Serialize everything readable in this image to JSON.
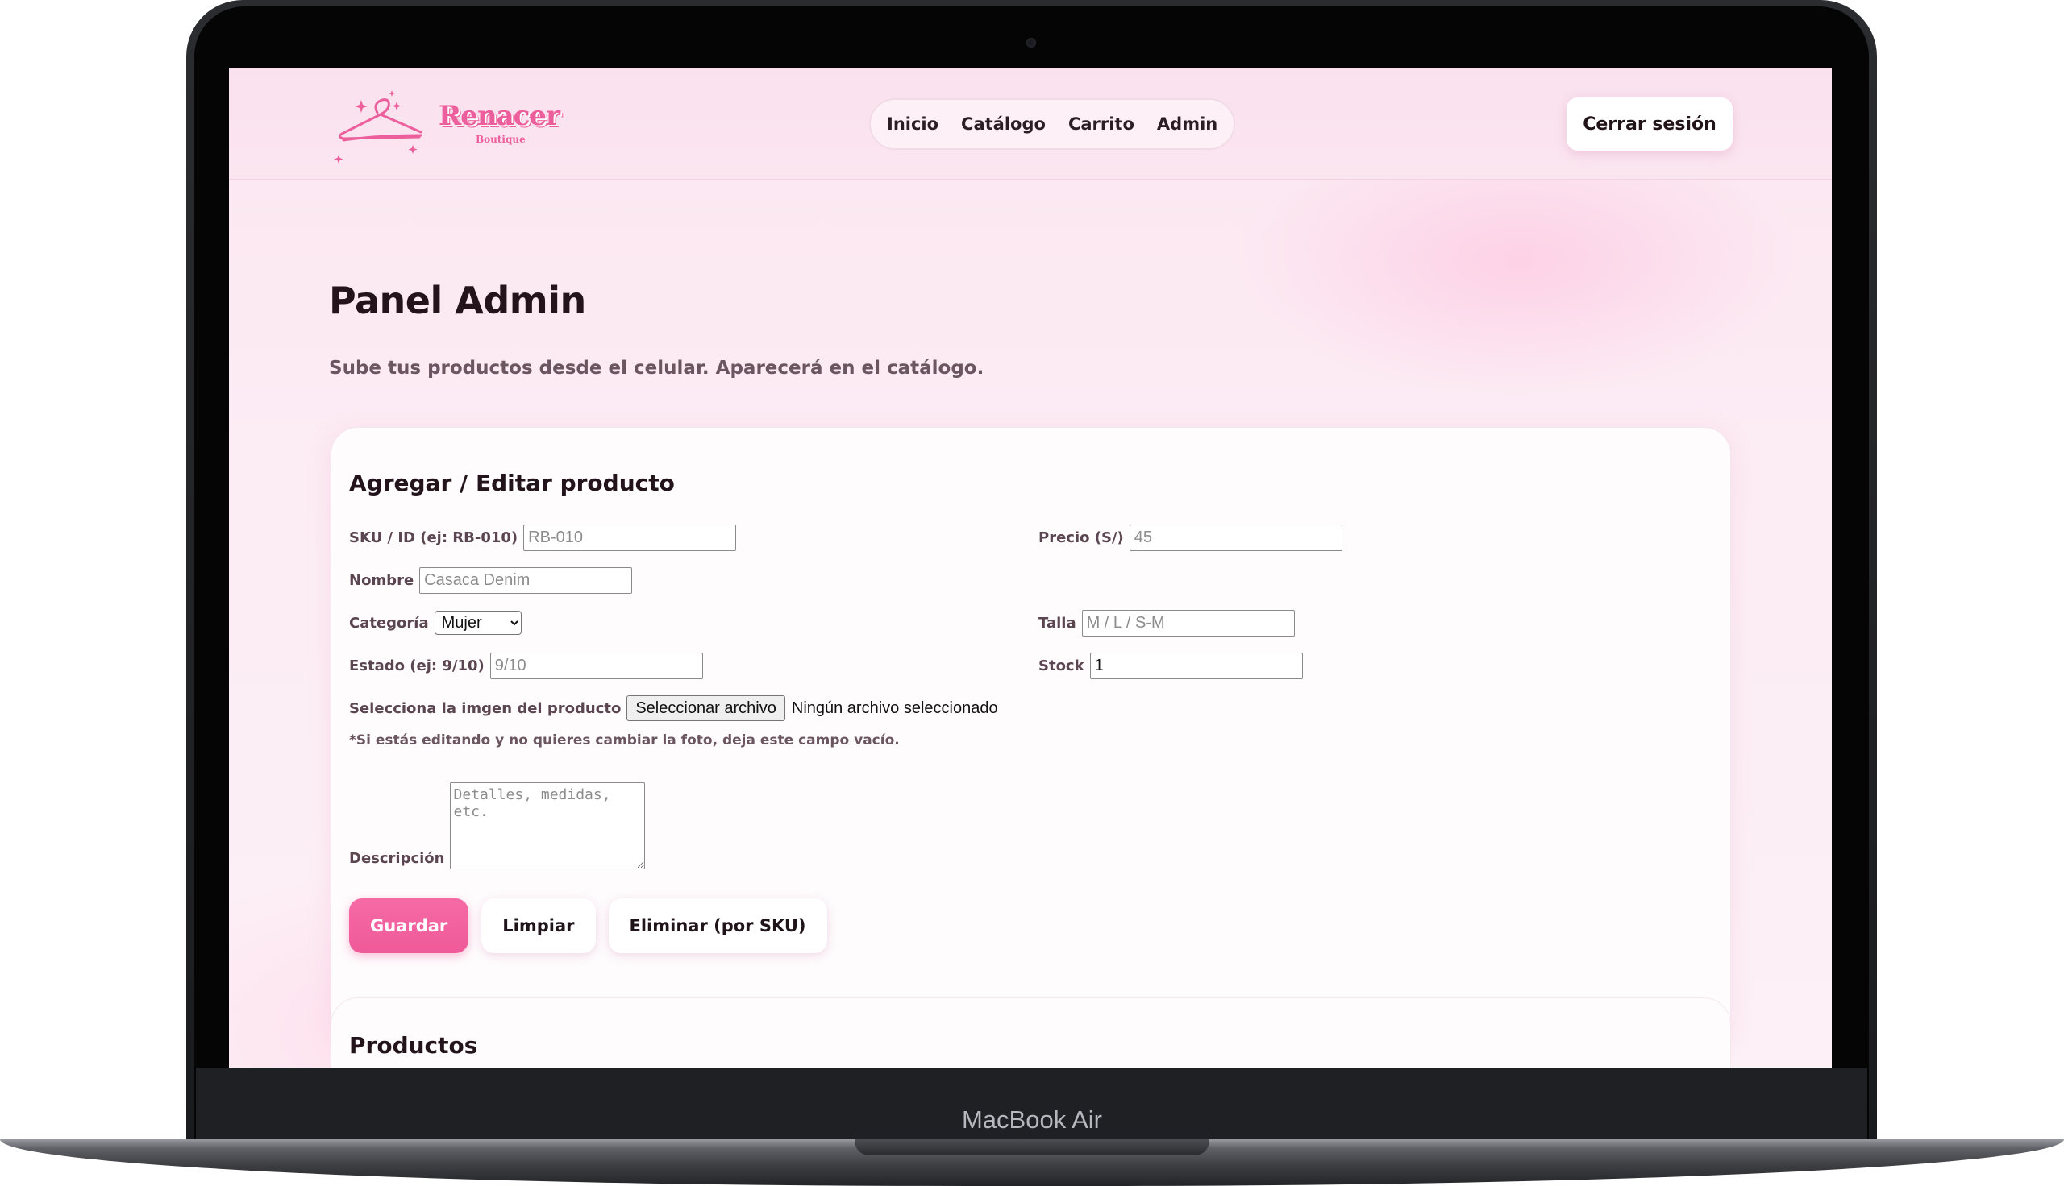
{
  "device": {
    "model_label": "MacBook Air"
  },
  "brand": {
    "name": "Renacer",
    "tagline": "Boutique",
    "accent_color": "#ef5a99"
  },
  "nav": {
    "items": [
      {
        "label": "Inicio"
      },
      {
        "label": "Catálogo"
      },
      {
        "label": "Carrito"
      },
      {
        "label": "Admin"
      }
    ],
    "logout_label": "Cerrar sesión"
  },
  "page": {
    "title": "Panel Admin",
    "subtitle": "Sube tus productos desde el celular. Aparecerá en el catálogo."
  },
  "form": {
    "title": "Agregar / Editar producto",
    "sku": {
      "label": "SKU / ID (ej: RB-010)",
      "value": "",
      "placeholder": "RB-010"
    },
    "price": {
      "label": "Precio (S/)",
      "value": "",
      "placeholder": "45"
    },
    "name": {
      "label": "Nombre",
      "value": "",
      "placeholder": "Casaca Denim"
    },
    "category": {
      "label": "Categoría",
      "selected": "Mujer"
    },
    "size": {
      "label": "Talla",
      "value": "",
      "placeholder": "M / L / S-M"
    },
    "condition": {
      "label": "Estado (ej: 9/10)",
      "value": "",
      "placeholder": "9/10"
    },
    "stock": {
      "label": "Stock",
      "value": "1",
      "placeholder": ""
    },
    "image": {
      "label": "Selecciona la imgen del producto",
      "button_label": "Seleccionar archivo",
      "status": "Ningún archivo seleccionado"
    },
    "hint": "*Si estás editando y no quieres cambiar la foto, deja este campo vacío.",
    "description": {
      "label": "Descripción",
      "placeholder": "Detalles, medidas, etc."
    },
    "buttons": {
      "save": "Guardar",
      "clear": "Limpiar",
      "delete": "Eliminar (por SKU)"
    }
  },
  "products": {
    "title": "Productos"
  }
}
